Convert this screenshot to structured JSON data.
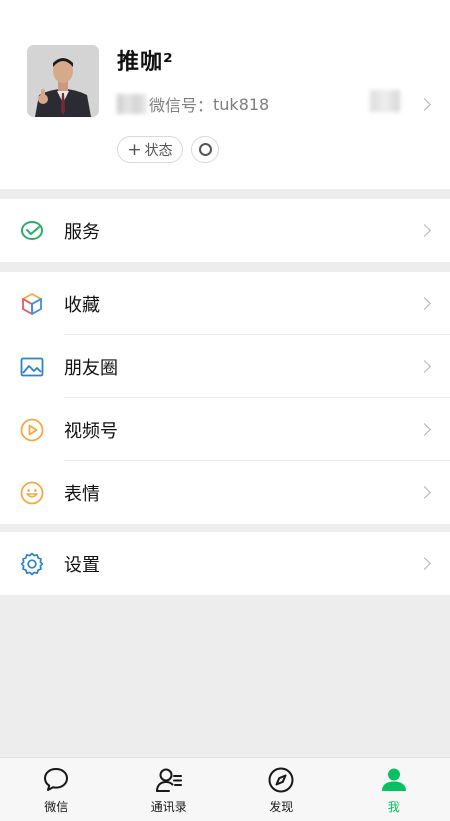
{
  "profile": {
    "nickname": "推咖²",
    "wechat_id_prefix": "微信号：",
    "wechat_id": "tuk818",
    "status_button_plus": "+",
    "status_button_label": "状态"
  },
  "menu": {
    "service": "服务",
    "favorites": "收藏",
    "moments": "朋友圈",
    "channels": "视频号",
    "stickers": "表情",
    "settings": "设置"
  },
  "tabs": [
    {
      "label": "微信",
      "icon": "chat-bubble-icon"
    },
    {
      "label": "通讯录",
      "icon": "contacts-icon"
    },
    {
      "label": "发现",
      "icon": "compass-icon"
    },
    {
      "label": "我",
      "icon": "person-icon"
    }
  ],
  "colors": {
    "accent_green": "#07c160",
    "service_green": "#2aae67",
    "moments_blue": "#2c82c9",
    "channels_orange": "#f4a941",
    "settings_blue": "#2c82c9"
  }
}
